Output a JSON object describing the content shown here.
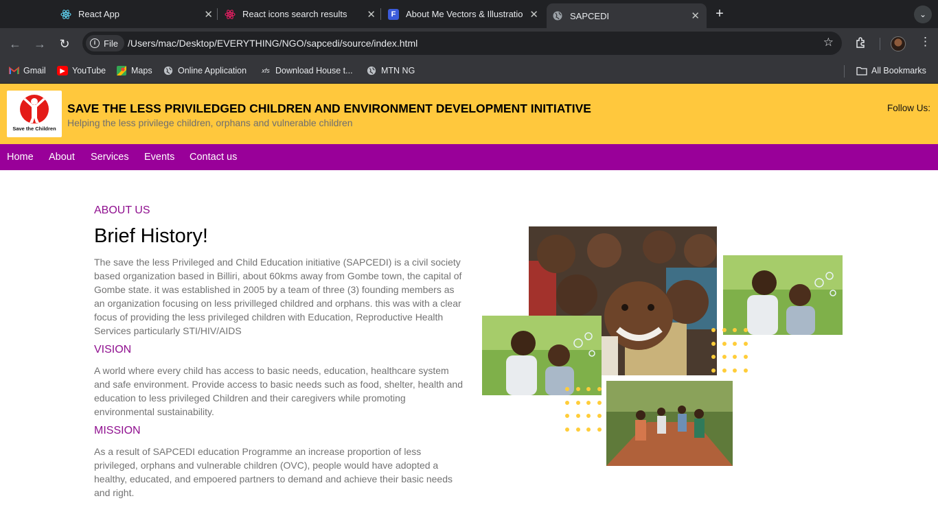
{
  "browser": {
    "tabs": [
      {
        "title": "React App",
        "icon": "react-icon",
        "active": false
      },
      {
        "title": "React icons search results",
        "icon": "react-icons-icon",
        "active": false
      },
      {
        "title": "About Me Vectors & Illustrations",
        "icon": "freepik-icon",
        "active": false
      },
      {
        "title": "SAPCEDI",
        "icon": "globe-icon",
        "active": true
      }
    ],
    "address": {
      "chip_label": "File",
      "url": "/Users/mac/Desktop/EVERYTHING/NGO/sapcedi/source/index.html"
    },
    "bookmarks": [
      {
        "label": "Gmail",
        "icon": "gmail-icon"
      },
      {
        "label": "YouTube",
        "icon": "youtube-icon"
      },
      {
        "label": "Maps",
        "icon": "maps-icon"
      },
      {
        "label": "Online Application",
        "icon": "globe-icon"
      },
      {
        "label": "Download House t...",
        "icon": "xfs-icon"
      },
      {
        "label": "MTN NG",
        "icon": "globe-icon"
      }
    ],
    "all_bookmarks": "All Bookmarks"
  },
  "header": {
    "logo_text": "Save the Children",
    "title": "SAVE THE LESS PRIVILEDGED CHILDREN AND ENVIRONMENT DEVELOPMENT INITIATIVE",
    "tagline": "Helping the less privilege children, orphans and vulnerable children",
    "follow": "Follow Us:"
  },
  "nav": [
    "Home",
    "About",
    "Services",
    "Events",
    "Contact us"
  ],
  "about": {
    "label": "ABOUT US",
    "heading": "Brief History!",
    "history": "The save the less Privileged and Child Education initiative (SAPCEDI) is a civil society based organization based in Billiri, about 60kms away from Gombe town, the capital of Gombe state. it was established in 2005 by a team of three (3) founding members as an organization focusing on less privilleged childred and orphans. this was with a clear focus of providing the less privileged children with Education, Reproductive Health Services particularly STI/HIV/AIDS",
    "vision_label": "VISION",
    "vision": "A world where every child has access to basic needs, education, healthcare system and safe environment. Provide access to basic needs such as food, shelter, health and education to less privileged Children and their caregivers while promoting environmental sustainability.",
    "mission_label": "MISSION",
    "mission": "As a result of SAPCEDI education Programme an increase proportion of less privileged, orphans and vulnerable children (OVC), people would have adopted a healthy, educated, and empoered partners to demand and achieve their basic needs and right."
  },
  "colors": {
    "header_bg": "#ffc83d",
    "nav_bg": "#990099",
    "accent": "#8f0f8f",
    "dots": "#ffcd3a"
  }
}
